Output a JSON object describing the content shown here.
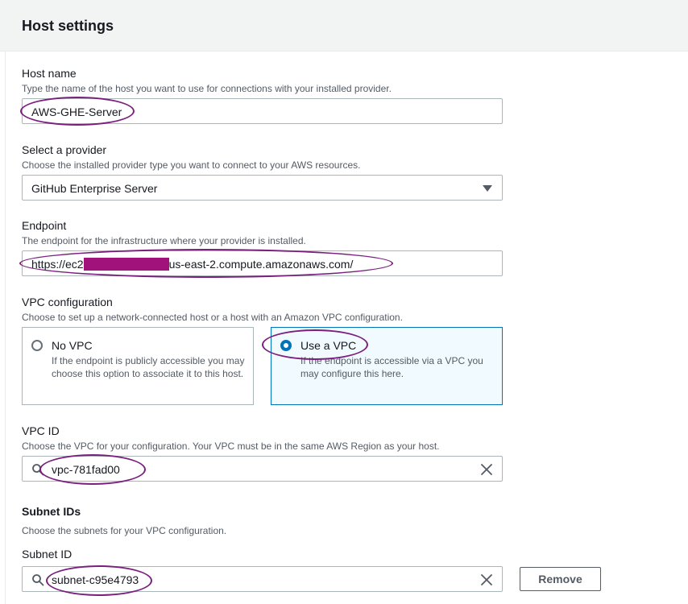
{
  "panel": {
    "title": "Host settings"
  },
  "host_name": {
    "label": "Host name",
    "description": "Type the name of the host you want to use for connections with your installed provider.",
    "value": "AWS-GHE-Server"
  },
  "provider": {
    "label": "Select a provider",
    "description": "Choose the installed provider type you want to connect to your AWS resources.",
    "value": "GitHub Enterprise Server"
  },
  "endpoint": {
    "label": "Endpoint",
    "description": "The endpoint for the infrastructure where your provider is installed.",
    "value_prefix": "https://ec2",
    "value_suffix": "us-east-2.compute.amazonaws.com/"
  },
  "vpc_config": {
    "label": "VPC configuration",
    "description": "Choose to set up a network-connected host or a host with an Amazon VPC configuration.",
    "options": [
      {
        "title": "No VPC",
        "description": "If the endpoint is publicly accessible you may choose this option to associate it to this host.",
        "selected": false
      },
      {
        "title": "Use a VPC",
        "description": "If the endpoint is accessible via a VPC you may configure this here.",
        "selected": true
      }
    ]
  },
  "vpc_id": {
    "label": "VPC ID",
    "description": "Choose the VPC for your configuration. Your VPC must be in the same AWS Region as your host.",
    "value": "vpc-781fad00"
  },
  "subnets": {
    "title": "Subnet IDs",
    "description": "Choose the subnets for your VPC configuration.",
    "subnet_label": "Subnet ID",
    "value": "subnet-c95e4793",
    "remove_label": "Remove"
  },
  "colors": {
    "accent": "#0073bb",
    "annotation": "#7b1f7e",
    "redaction": "#a1137a"
  },
  "icons": [
    "search-icon",
    "clear-icon",
    "chevron-down-icon",
    "radio-icon"
  ]
}
